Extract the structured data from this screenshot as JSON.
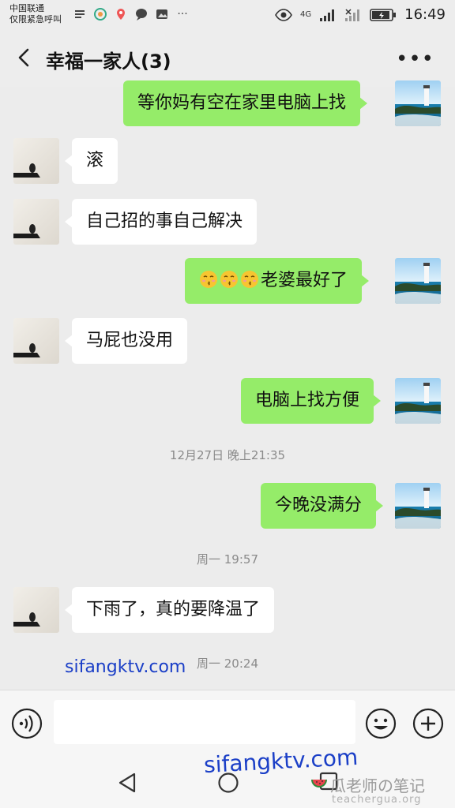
{
  "status_bar": {
    "carrier_line1": "中国联通",
    "carrier_line2": "仅限紧急呼叫",
    "network": "4G",
    "time": "16:49"
  },
  "header": {
    "title": "幸福一家人(3)"
  },
  "messages": [
    {
      "side": "self",
      "text": "等你妈有空在家里电脑上找"
    },
    {
      "side": "other",
      "text": "滚"
    },
    {
      "side": "other",
      "text": "自己招的事自己解决"
    },
    {
      "side": "self",
      "text": "老婆最好了",
      "emoji_prefix": [
        "kiss-emoji",
        "kiss-emoji",
        "kiss-emoji"
      ]
    },
    {
      "side": "other",
      "text": "马屁也没用"
    },
    {
      "side": "self",
      "text": "电脑上找方便"
    },
    {
      "side": "self",
      "text": "今晚没满分"
    },
    {
      "side": "other",
      "text": "下雨了，真的要降温了"
    }
  ],
  "timestamps": [
    "12月27日 晚上21:35",
    "周一 19:57",
    "周一 20:24"
  ],
  "watermarks": {
    "site1": "sifangktv.com",
    "site2": "sifangktv.com",
    "brand": "瓜老师の笔记",
    "brand_url": "teachergua.org"
  },
  "colors": {
    "self_bubble": "#95ec69",
    "other_bubble": "#ffffff",
    "background": "#ececec"
  }
}
